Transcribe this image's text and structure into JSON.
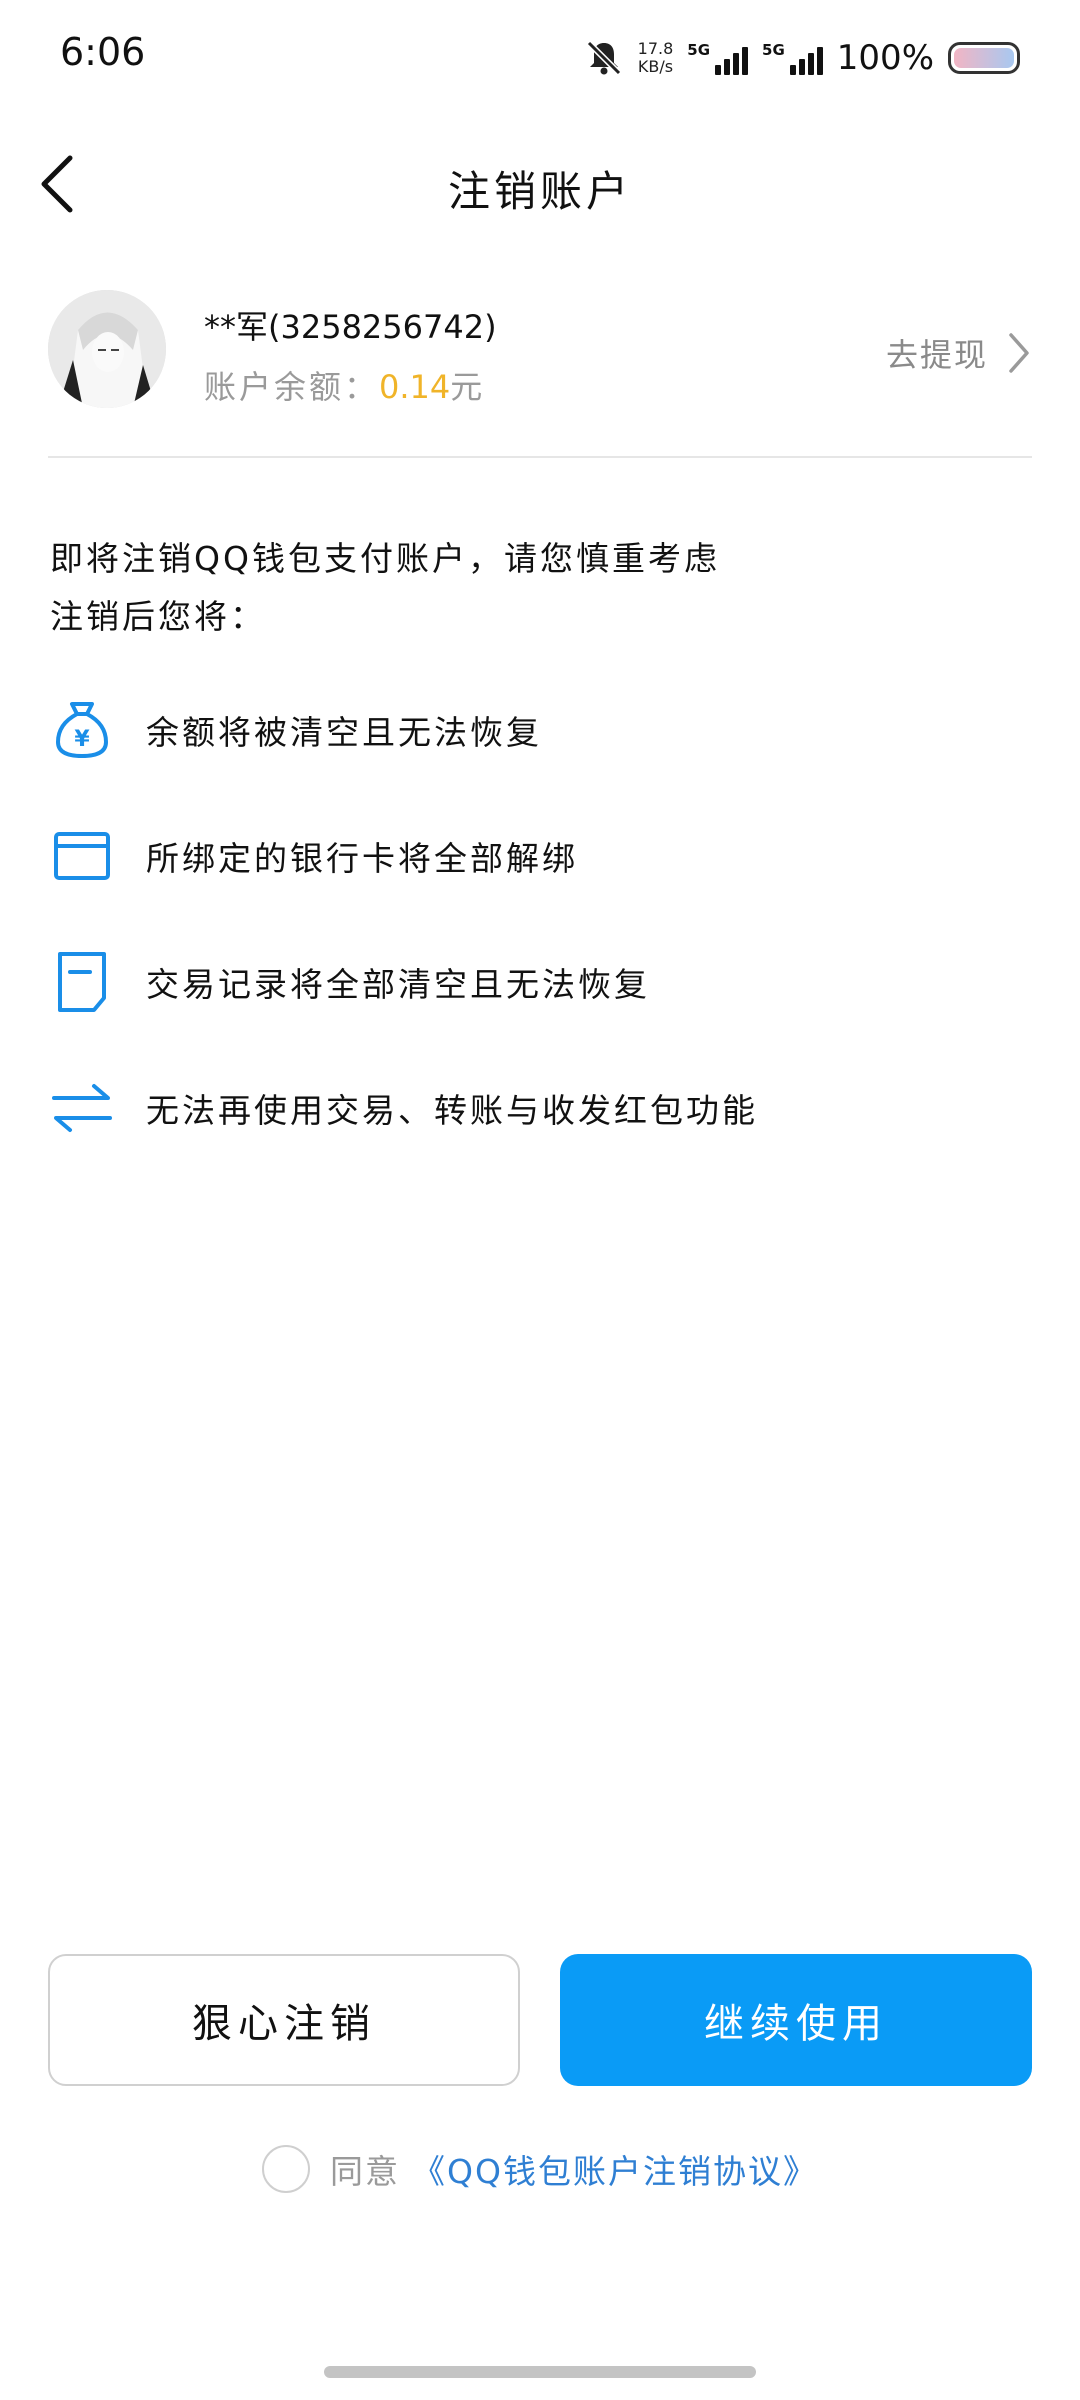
{
  "status_bar": {
    "time": "6:06",
    "net_speed_value": "17.8",
    "net_speed_unit": "KB/s",
    "sim1_label": "5G",
    "sim2_label": "5G",
    "battery": "100%",
    "icons": [
      "bell-off-icon",
      "signal-icon",
      "battery-icon"
    ]
  },
  "header": {
    "title": "注销账户",
    "back_icon": "chevron-left-icon"
  },
  "account": {
    "name": "**军(3258256742)",
    "balance_label": "账户余额：",
    "balance_amount": "0.14",
    "balance_unit": "元",
    "withdraw_label": "去提现",
    "balance_color": "#f0b429"
  },
  "warning": {
    "line1": "即将注销QQ钱包支付账户，请您慎重考虑",
    "line2": "注销后您将：",
    "items": [
      {
        "icon": "money-bag-icon",
        "text": "余额将被清空且无法恢复"
      },
      {
        "icon": "bank-card-icon",
        "text": "所绑定的银行卡将全部解绑"
      },
      {
        "icon": "document-icon",
        "text": "交易记录将全部清空且无法恢复"
      },
      {
        "icon": "transfer-arrows-icon",
        "text": "无法再使用交易、转账与收发红包功能"
      }
    ]
  },
  "actions": {
    "cancel_label": "狠心注销",
    "continue_label": "继续使用",
    "primary_color": "#0a9bf6"
  },
  "agreement": {
    "agree_label": "同意",
    "link_text": "《QQ钱包账户注销协议》"
  }
}
